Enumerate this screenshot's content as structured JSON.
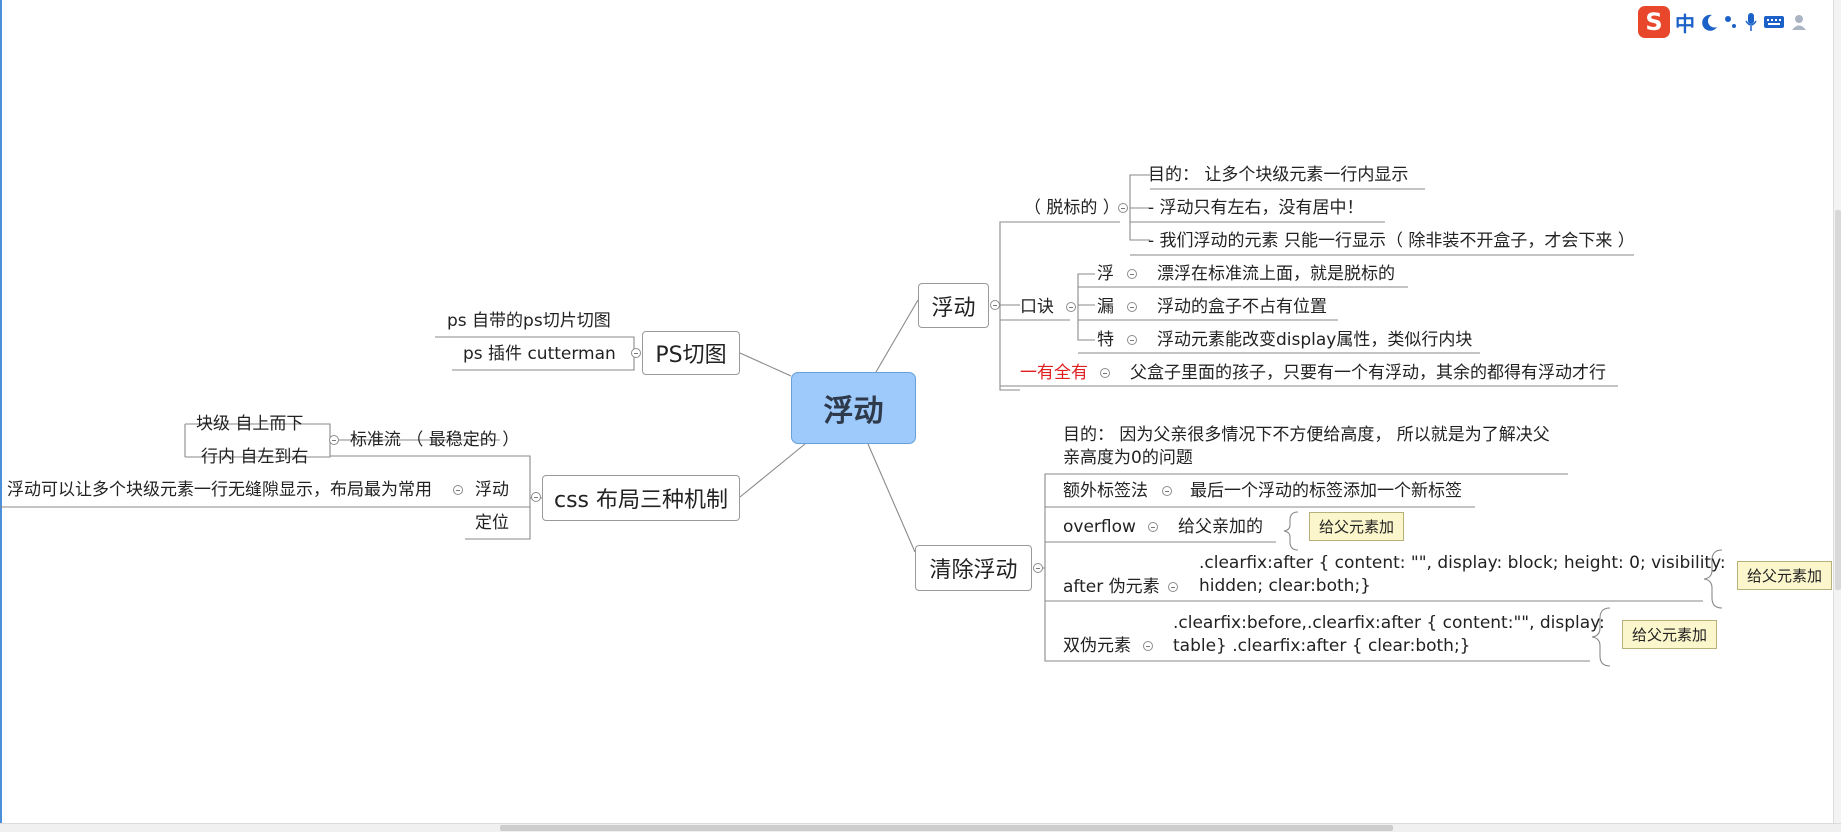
{
  "central": "浮动",
  "ps_slicing": {
    "label": "PS切图",
    "items": [
      "ps 自带的ps切片切图",
      "ps 插件 cutterman"
    ]
  },
  "css_layout": {
    "label": "css 布局三种机制",
    "standard_flow": {
      "label": "标准流 （ 最稳定的 ）",
      "items": [
        "块级  自上而下",
        "行内 自左到右"
      ]
    },
    "float": {
      "label": "浮动",
      "note": "浮动可以让多个块级元素一行无缝隙显示，布局最为常用"
    },
    "position": "定位"
  },
  "float_branch": {
    "label": "浮动",
    "tuobiao": {
      "label": "（ 脱标的 ）",
      "items": [
        "目的：  让多个块级元素一行内显示",
        "- 浮动只有左右，没有居中！",
        "- 我们浮动的元素 只能一行显示（ 除非装不开盒子，才会下来 ）"
      ]
    },
    "koujue": {
      "label": "口诀",
      "items": [
        {
          "key": "浮",
          "value": "漂浮在标准流上面，就是脱标的"
        },
        {
          "key": "漏",
          "value": "浮动的盒子不占有位置"
        },
        {
          "key": "特",
          "value": "浮动元素能改变display属性，类似行内块"
        }
      ]
    },
    "yiyouquanyou": {
      "label": "一有全有",
      "value": "父盒子里面的孩子，只要有一个有浮动，其余的都得有浮动才行"
    }
  },
  "clear_float": {
    "label": "清除浮动",
    "purpose_line1": "目的：  因为父亲很多情况下不方便给高度， 所以就是为了解决父",
    "purpose_line2": "亲高度为0的问题",
    "extra_tag": {
      "label": "额外标签法",
      "value": "最后一个浮动的标签添加一个新标签"
    },
    "overflow": {
      "label": "overflow",
      "value": "给父亲加的",
      "callout": "给父元素加"
    },
    "after": {
      "label": "after 伪元素",
      "code_line1": ".clearfix:after { content: \"\", display: block; height: 0; visibility:",
      "code_line2": "hidden;  clear:both;}",
      "callout": "给父元素加"
    },
    "double": {
      "label": "双伪元素",
      "code_line1": ".clearfix:before,.clearfix:after { content:\"\", display:",
      "code_line2": "table}  .clearfix:after { clear:both;}",
      "callout": "给父元素加"
    }
  },
  "ime": {
    "logo": "S",
    "mode": "中"
  },
  "colors": {
    "central_fill": "#9dc9fb",
    "highlight_red": "#e02020",
    "callout_fill": "#fbf6cc"
  }
}
